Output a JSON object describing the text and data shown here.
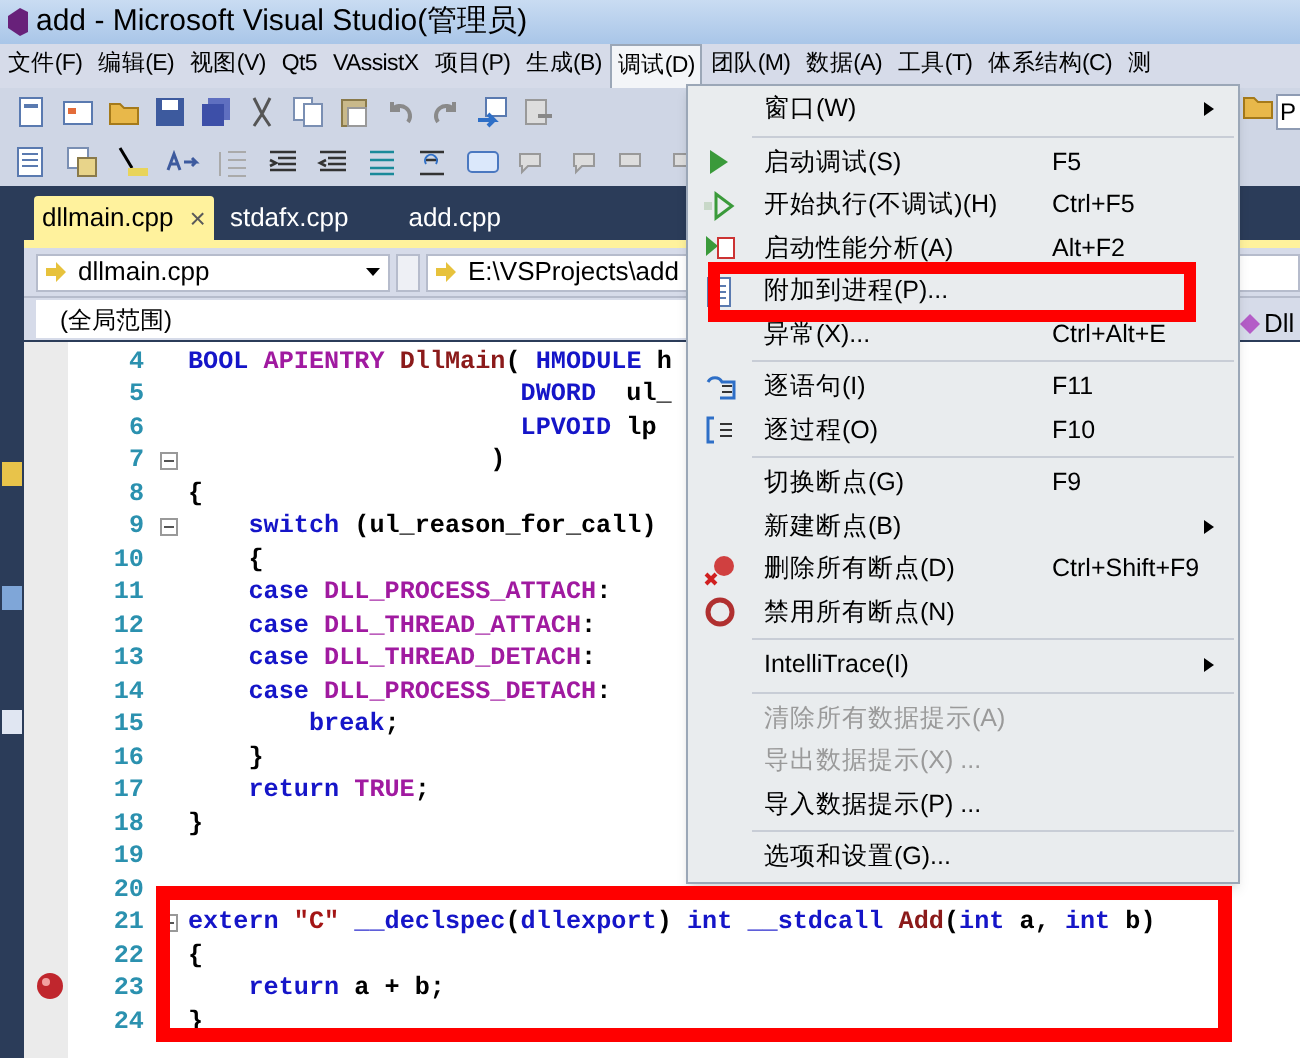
{
  "window": {
    "title": "add - Microsoft Visual Studio(管理员)"
  },
  "menubar": [
    {
      "label": "文件(F)",
      "selected": false
    },
    {
      "label": "编辑(E)",
      "selected": false
    },
    {
      "label": "视图(V)",
      "selected": false
    },
    {
      "label": "Qt5",
      "selected": false
    },
    {
      "label": "VAssistX",
      "selected": false
    },
    {
      "label": "项目(P)",
      "selected": false
    },
    {
      "label": "生成(B)",
      "selected": false
    },
    {
      "label": "调试(D)",
      "selected": true
    },
    {
      "label": "团队(M)",
      "selected": false
    },
    {
      "label": "数据(A)",
      "selected": false
    },
    {
      "label": "工具(T)",
      "selected": false
    },
    {
      "label": "体系结构(C)",
      "selected": false
    },
    {
      "label": "测",
      "selected": false
    }
  ],
  "toolbar_field": {
    "value": "P"
  },
  "tabs": [
    {
      "label": "dllmain.cpp",
      "selected": true,
      "close": "×"
    },
    {
      "label": "stdafx.cpp",
      "selected": false
    },
    {
      "label": "add.cpp",
      "selected": false
    }
  ],
  "navigation": {
    "file": "dllmain.cpp",
    "path": "E:\\VSProjects\\add",
    "scope": "(全局范围)",
    "member": "Dll"
  },
  "debug_menu": [
    {
      "kind": "item",
      "label": "窗口(W)",
      "submenu": true,
      "disabled": false
    },
    {
      "kind": "separator"
    },
    {
      "kind": "item",
      "label": "启动调试(S)",
      "shortcut": "F5",
      "disabled": false
    },
    {
      "kind": "item",
      "label": "开始执行(不调试)(H)",
      "shortcut": "Ctrl+F5",
      "disabled": false
    },
    {
      "kind": "item",
      "label": "启动性能分析(A)",
      "shortcut": "Alt+F2",
      "disabled": false
    },
    {
      "kind": "item",
      "label": "附加到进程(P)...",
      "disabled": false,
      "highlighted": true
    },
    {
      "kind": "item",
      "label": "异常(X)...",
      "shortcut": "Ctrl+Alt+E",
      "disabled": false
    },
    {
      "kind": "separator"
    },
    {
      "kind": "item",
      "label": "逐语句(I)",
      "shortcut": "F11",
      "disabled": false
    },
    {
      "kind": "item",
      "label": "逐过程(O)",
      "shortcut": "F10",
      "disabled": false
    },
    {
      "kind": "separator"
    },
    {
      "kind": "item",
      "label": "切换断点(G)",
      "shortcut": "F9",
      "disabled": false
    },
    {
      "kind": "item",
      "label": "新建断点(B)",
      "submenu": true,
      "disabled": false
    },
    {
      "kind": "item",
      "label": "删除所有断点(D)",
      "shortcut": "Ctrl+Shift+F9",
      "disabled": false
    },
    {
      "kind": "item",
      "label": "禁用所有断点(N)",
      "disabled": false
    },
    {
      "kind": "separator"
    },
    {
      "kind": "item",
      "label": "IntelliTrace(I)",
      "submenu": true,
      "disabled": false
    },
    {
      "kind": "separator"
    },
    {
      "kind": "item",
      "label": "清除所有数据提示(A)",
      "disabled": true
    },
    {
      "kind": "item",
      "label": "导出数据提示(X) ...",
      "disabled": true
    },
    {
      "kind": "item",
      "label": "导入数据提示(P) ...",
      "disabled": false
    },
    {
      "kind": "separator"
    },
    {
      "kind": "item",
      "label": "选项和设置(G)...",
      "disabled": false
    }
  ],
  "code": [
    {
      "line": "4",
      "tokens": [
        {
          "text": "BOOL",
          "kind": "keyword"
        },
        {
          "text": " APIENTRY",
          "kind": "macro"
        },
        {
          "text": " DllMain",
          "kind": "function"
        },
        {
          "text": "( "
        },
        {
          "text": "HMODULE",
          "kind": "keyword"
        },
        {
          "text": " h"
        }
      ]
    },
    {
      "line": "5",
      "tokens": [
        {
          "text": "                      DWORD",
          "kind": "keyword"
        },
        {
          "text": "  ul_"
        }
      ]
    },
    {
      "line": "6",
      "tokens": [
        {
          "text": "                      LPVOID",
          "kind": "keyword"
        },
        {
          "text": " lp"
        }
      ]
    },
    {
      "line": "7",
      "foldable": true,
      "tokens": [
        {
          "text": "                    )"
        }
      ]
    },
    {
      "line": "8",
      "tokens": [
        {
          "text": "{"
        }
      ]
    },
    {
      "line": "9",
      "foldable": true,
      "tokens": [
        {
          "text": "    switch",
          "kind": "keyword"
        },
        {
          "text": " (ul_reason_for_call)"
        }
      ]
    },
    {
      "line": "10",
      "tokens": [
        {
          "text": "    {"
        }
      ]
    },
    {
      "line": "11",
      "tokens": [
        {
          "text": "    case",
          "kind": "keyword"
        },
        {
          "text": " DLL_PROCESS_ATTACH",
          "kind": "macro"
        },
        {
          "text": ":"
        }
      ]
    },
    {
      "line": "12",
      "tokens": [
        {
          "text": "    case",
          "kind": "keyword"
        },
        {
          "text": " DLL_THREAD_ATTACH",
          "kind": "macro"
        },
        {
          "text": ":"
        }
      ]
    },
    {
      "line": "13",
      "tokens": [
        {
          "text": "    case",
          "kind": "keyword"
        },
        {
          "text": " DLL_THREAD_DETACH",
          "kind": "macro"
        },
        {
          "text": ":"
        }
      ]
    },
    {
      "line": "14",
      "tokens": [
        {
          "text": "    case",
          "kind": "keyword"
        },
        {
          "text": " DLL_PROCESS_DETACH",
          "kind": "macro"
        },
        {
          "text": ":"
        }
      ]
    },
    {
      "line": "15",
      "tokens": [
        {
          "text": "        break",
          "kind": "keyword"
        },
        {
          "text": ";"
        }
      ]
    },
    {
      "line": "16",
      "tokens": [
        {
          "text": "    }"
        }
      ]
    },
    {
      "line": "17",
      "tokens": [
        {
          "text": "    return",
          "kind": "keyword"
        },
        {
          "text": " TRUE",
          "kind": "macro"
        },
        {
          "text": ";"
        }
      ]
    },
    {
      "line": "18",
      "tokens": [
        {
          "text": "}"
        }
      ]
    },
    {
      "line": "19"
    },
    {
      "line": "20"
    },
    {
      "line": "21",
      "foldable": true,
      "tokens": [
        {
          "text": "extern",
          "kind": "keyword"
        },
        {
          "text": " \"C\"",
          "kind": "string"
        },
        {
          "text": " __declspec",
          "kind": "keyword"
        },
        {
          "text": "("
        },
        {
          "text": "dllexport",
          "kind": "keyword"
        },
        {
          "text": ") "
        },
        {
          "text": "int",
          "kind": "keyword"
        },
        {
          "text": " __stdcall",
          "kind": "keyword"
        },
        {
          "text": " Add",
          "kind": "function"
        },
        {
          "text": "("
        },
        {
          "text": "int",
          "kind": "keyword"
        },
        {
          "text": " a, "
        },
        {
          "text": "int",
          "kind": "keyword"
        },
        {
          "text": " b)"
        }
      ]
    },
    {
      "line": "22",
      "tokens": [
        {
          "text": "{"
        }
      ]
    },
    {
      "line": "23",
      "breakpoint": true,
      "tokens": [
        {
          "text": "    return",
          "kind": "keyword"
        },
        {
          "text": " a + b;"
        }
      ]
    },
    {
      "line": "24",
      "tokens": [
        {
          "text": "}"
        }
      ]
    }
  ]
}
